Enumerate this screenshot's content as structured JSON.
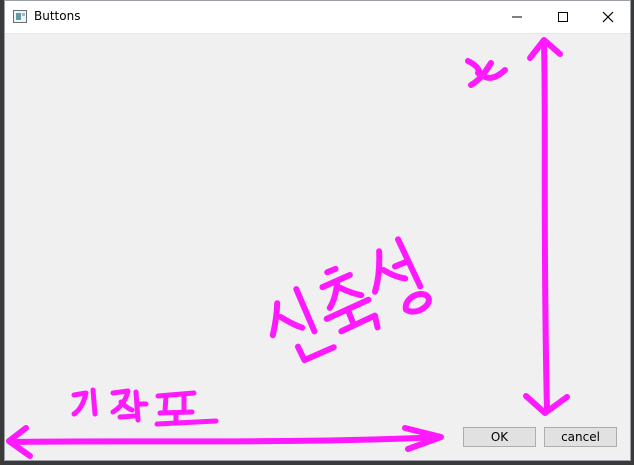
{
  "window": {
    "title": "Buttons",
    "icon": "app-window-icon",
    "controls": [
      "minimize-icon",
      "maximize-icon",
      "close-icon"
    ]
  },
  "buttons": {
    "ok_label": "OK",
    "cancel_label": "cancel"
  },
  "annotations": {
    "color": "#ff19ff",
    "y_label": "y",
    "x_label": "x 좌표",
    "center_label": "신축성"
  }
}
